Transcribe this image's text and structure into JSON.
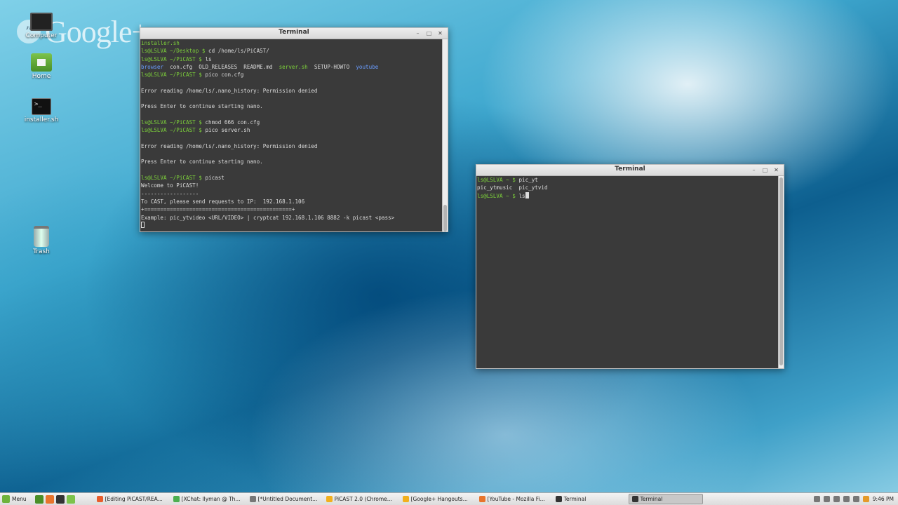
{
  "watermark": {
    "bubble": "”",
    "text": "Google+"
  },
  "desktop_icons": [
    {
      "label": "Computer"
    },
    {
      "label": "Home"
    },
    {
      "label": "installer.sh"
    },
    {
      "label": "Trash"
    }
  ],
  "terminal1": {
    "title": "Terminal",
    "controls": {
      "minimize": "–",
      "maximize": "□",
      "close": "✕"
    },
    "lines": [
      [
        {
          "t": "installer.sh",
          "c": "g"
        }
      ],
      [
        {
          "t": "ls@LSLVA ~/Desktop $ ",
          "c": "g"
        },
        {
          "t": "cd /home/ls/PiCAST/"
        }
      ],
      [
        {
          "t": "ls@LSLVA ~/PiCAST $ ",
          "c": "g"
        },
        {
          "t": "ls"
        }
      ],
      [
        {
          "t": "browser",
          "c": "b"
        },
        {
          "t": "  con.cfg  OLD_RELEASES  README.md  "
        },
        {
          "t": "server.sh",
          "c": "g"
        },
        {
          "t": "  SETUP-HOWTO  "
        },
        {
          "t": "youtube",
          "c": "b"
        }
      ],
      [
        {
          "t": "ls@LSLVA ~/PiCAST $ ",
          "c": "g"
        },
        {
          "t": "pico con.cfg"
        }
      ],
      [],
      [
        {
          "t": "Error reading /home/ls/.nano_history: Permission denied"
        }
      ],
      [],
      [
        {
          "t": "Press Enter to continue starting nano."
        }
      ],
      [],
      [
        {
          "t": "ls@LSLVA ~/PiCAST $ ",
          "c": "g"
        },
        {
          "t": "chmod 666 con.cfg"
        }
      ],
      [
        {
          "t": "ls@LSLVA ~/PiCAST $ ",
          "c": "g"
        },
        {
          "t": "pico server.sh"
        }
      ],
      [],
      [
        {
          "t": "Error reading /home/ls/.nano_history: Permission denied"
        }
      ],
      [],
      [
        {
          "t": "Press Enter to continue starting nano."
        }
      ],
      [],
      [
        {
          "t": "ls@LSLVA ~/PiCAST $ ",
          "c": "g"
        },
        {
          "t": "picast"
        }
      ],
      [
        {
          "t": "Welcome to PiCAST!"
        }
      ],
      [
        {
          "t": "------------------"
        }
      ],
      [
        {
          "t": "To CAST, please send requests to IP:  192.168.1.106"
        }
      ],
      [
        {
          "t": "+==============================================+"
        }
      ],
      [
        {
          "t": "Example: pic_ytvideo <URL/VIDEO> | cryptcat 192.168.1.106 8882 -k picast <pass>"
        }
      ]
    ]
  },
  "terminal2": {
    "title": "Terminal",
    "controls": {
      "minimize": "–",
      "maximize": "□",
      "close": "✕"
    },
    "lines": [
      [
        {
          "t": "ls@LSLVA ~ $ ",
          "c": "g"
        },
        {
          "t": "pic_yt"
        }
      ],
      [
        {
          "t": "pic_ytmusic  pic_ytvid"
        }
      ],
      [
        {
          "t": "ls@LSLVA ~ $ ",
          "c": "g"
        },
        {
          "t": "ls"
        }
      ]
    ]
  },
  "taskbar": {
    "menu_label": "Menu",
    "tasks": [
      {
        "label": "[Editing PiCAST/REA...",
        "color": "#e85d2c",
        "active": false
      },
      {
        "label": "[XChat: llyman @ Th...",
        "color": "#4caf50",
        "active": false
      },
      {
        "label": "[*Untitled Document...",
        "color": "#777777",
        "active": false
      },
      {
        "label": "PiCAST 2.0 (Chrome...",
        "color": "#f2b01e",
        "active": false
      },
      {
        "label": "[Google+ Hangouts...",
        "color": "#f2b01e",
        "active": false
      },
      {
        "label": "[YouTube - Mozilla Fi...",
        "color": "#e8742c",
        "active": false
      },
      {
        "label": "Terminal",
        "color": "#333333",
        "active": false
      },
      {
        "label": "Terminal",
        "color": "#333333",
        "active": true
      }
    ],
    "clock": "9:46 PM"
  }
}
